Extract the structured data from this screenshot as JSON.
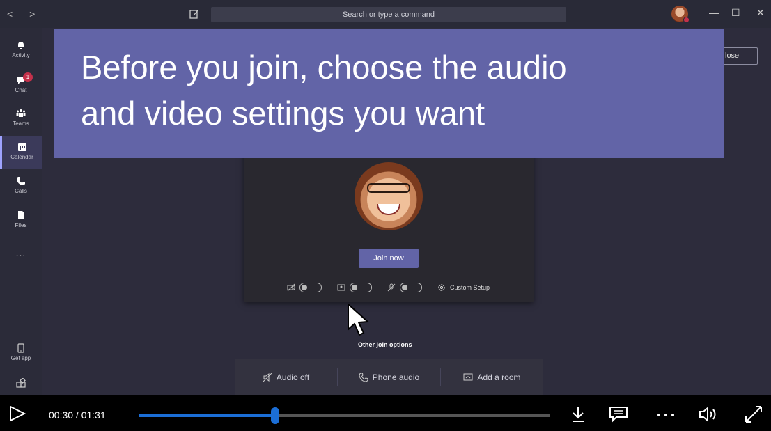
{
  "titlebar": {
    "nav": "< >",
    "search_placeholder": "Search or type a command"
  },
  "rail": {
    "items": [
      {
        "label": "Activity"
      },
      {
        "label": "Chat",
        "badge": "1"
      },
      {
        "label": "Teams"
      },
      {
        "label": "Calendar"
      },
      {
        "label": "Calls"
      },
      {
        "label": "Files"
      }
    ],
    "more": "...",
    "get_app": "Get app"
  },
  "main": {
    "close_label": "lose",
    "join_now": "Join now",
    "custom_setup": "Custom Setup",
    "other_join_options": "Other join options",
    "options": [
      "Audio off",
      "Phone audio",
      "Add a room"
    ]
  },
  "caption": {
    "line1": "Before you join, choose the audio",
    "line2": "and video settings you want"
  },
  "player": {
    "time": "00:30 / 01:31",
    "progress": 0.33
  },
  "colors": {
    "accent": "#6264a7",
    "progress": "#1b6ed6",
    "badge": "#c4314b"
  }
}
